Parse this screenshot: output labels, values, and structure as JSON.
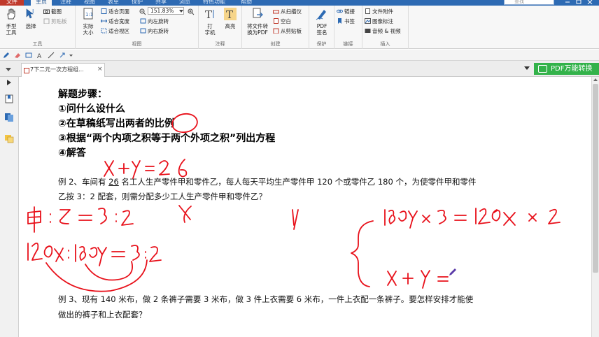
{
  "menu": {
    "tabs": [
      "文件",
      "主页",
      "注释",
      "视图",
      "表单",
      "保护",
      "共享",
      "浏览",
      "特色功能",
      "帮助"
    ],
    "active": "主页",
    "search_placeholder": "查找"
  },
  "ribbon": {
    "tools": {
      "hand": "手型\n工具",
      "select": "选择",
      "screenshot": "截图",
      "clipboard": "剪贴板",
      "group": "工具"
    },
    "view": {
      "actual_size": "实际\n大小",
      "fit_page": "适合页面",
      "fit_width": "适合宽度",
      "fit_visible": "适合视区",
      "zoom": "151.83%",
      "rotate_left": "向左旋转",
      "rotate_right": "向右旋转",
      "group": "视图"
    },
    "comment": {
      "typewriter": "打\n字机",
      "highlight": "高亮",
      "group": "注释"
    },
    "create": {
      "to_pdf": "将文件转\n换为PDF",
      "from_scanner": "从扫描仪",
      "blank": "空白",
      "from_clipboard": "从剪贴板",
      "group": "创建"
    },
    "protect": {
      "pdf_sign": "PDF\n签名",
      "group": "保护"
    },
    "links": {
      "link": "链接",
      "bookmark": "书签",
      "group": "链接"
    },
    "insert": {
      "attachment": "文件附件",
      "image": "图像标注",
      "audio_video": "音频 & 视频",
      "group": "插入"
    }
  },
  "tabbar": {
    "doc_tab": "7下二元一次方程组...",
    "close": "×",
    "pdf_convert": "PDF万能转换"
  },
  "document": {
    "step_title": "解题步骤：",
    "step1": "①问什么设什么",
    "step2": "②在草稿纸写出两者的比例",
    "step3": "③根据“两个内项之积等于两个外项之积”列出方程",
    "step4": "④解答",
    "example2_line1_pre": "例 2、车间有 ",
    "example2_num": "26",
    "example2_line1_post": " 名工人生产零件甲和零件乙，每人每天平均生产零件甲 120 个或零件乙 180 个，为使零件甲和零件",
    "example2_line2": "乙按 3：2 配套，则需分配多少工人生产零件甲和零件乙？",
    "example3_line1": "例 3、现有 140 米布，做 2 条裤子需要 3 米布，做 3 件上衣需要 6 米布，一件上衣配一条裤子。要怎样安排才能使",
    "example3_line2": "做出的裤子和上衣配套？"
  },
  "colors": {
    "accent": "#2d6ab3",
    "ink": "#e8101a",
    "convert": "#33b24a",
    "file_tab": "#c0392b"
  }
}
